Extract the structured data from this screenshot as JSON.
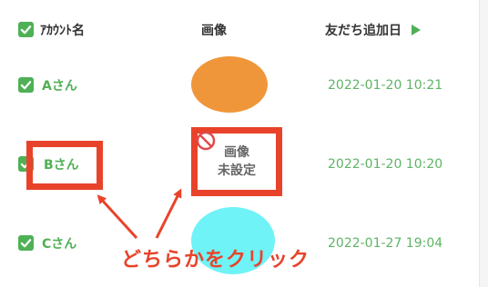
{
  "header": {
    "account_name": "ｱｶｳﾝﾄ名",
    "image": "画像",
    "friend_added_date": "友だち追加日"
  },
  "rows": [
    {
      "name": "Aさん",
      "date": "2022-01-20 10:21",
      "image_color": "#f0963a"
    },
    {
      "name": "Bさん",
      "date": "2022-01-20 10:20",
      "image_placeholder_line1": "画像",
      "image_placeholder_line2": "未設定"
    },
    {
      "name": "Cさん",
      "date": "2022-01-27 19:04",
      "image_color": "#6ff3f7"
    }
  ],
  "annotation": {
    "text": "どちらかをクリック",
    "color": "#e8432a"
  },
  "colors": {
    "checkbox": "#4fb055",
    "name_text": "#4fb055",
    "date_text": "#5fb466"
  }
}
